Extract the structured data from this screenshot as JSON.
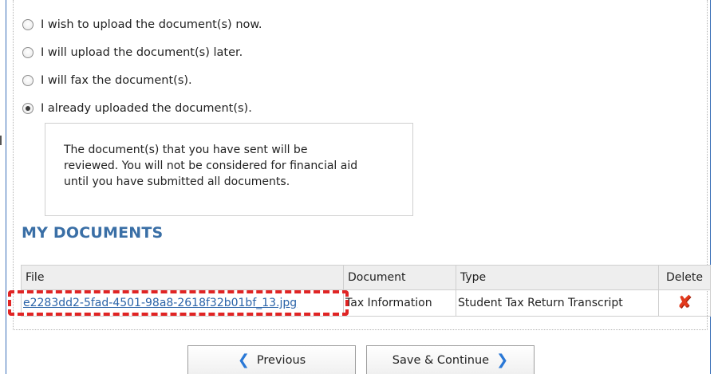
{
  "options": [
    {
      "label": "I wish to upload the document(s) now.",
      "checked": false
    },
    {
      "label": "I will upload the document(s) later.",
      "checked": false
    },
    {
      "label": "I will fax the document(s).",
      "checked": false
    },
    {
      "label": "I already uploaded the document(s).",
      "checked": true
    }
  ],
  "info_box": {
    "line1": "The document(s) that you have sent will be",
    "line2": "reviewed. You will not be considered for financial aid",
    "line3": "until you have submitted all documents."
  },
  "section_title": "MY DOCUMENTS",
  "table": {
    "headers": {
      "file": "File",
      "document": "Document",
      "type": "Type",
      "delete": "Delete"
    },
    "rows": [
      {
        "file": "e2283dd2-5fad-4501-98a8-2618f32b01bf_13.jpg",
        "document": "Tax Information",
        "type": "Student Tax Return Transcript",
        "delete_icon": "red-x-delete-icon"
      }
    ]
  },
  "buttons": {
    "previous": "Previous",
    "save_continue": "Save & Continue"
  },
  "colors": {
    "accent_blue": "#3a6fa6",
    "link_blue": "#2a63a8",
    "highlight_red": "#e02424"
  }
}
